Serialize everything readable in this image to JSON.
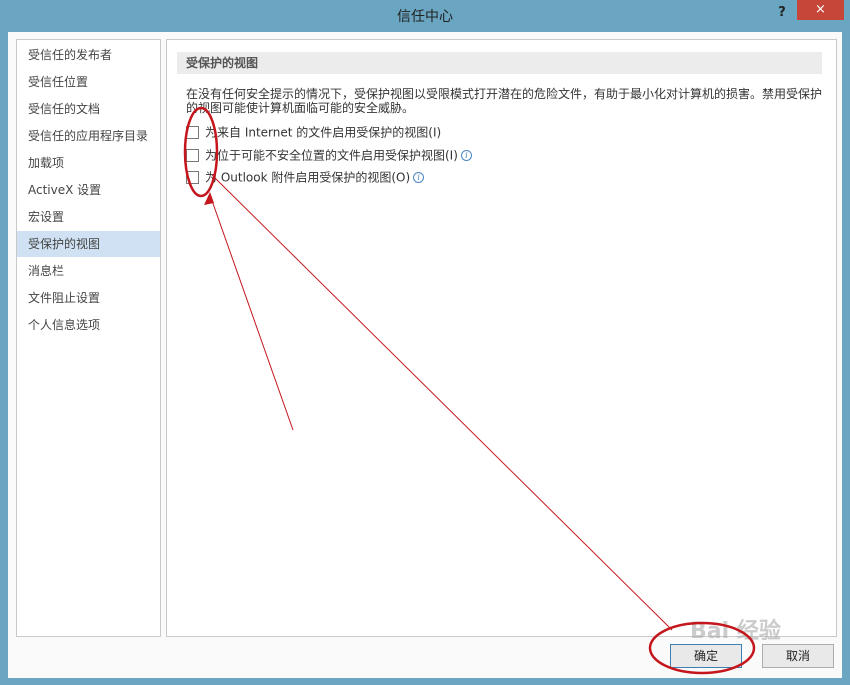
{
  "window": {
    "title": "信任中心",
    "help_label": "?",
    "close_label": "×"
  },
  "sidebar": {
    "items": [
      {
        "label": "受信任的发布者"
      },
      {
        "label": "受信任位置"
      },
      {
        "label": "受信任的文档"
      },
      {
        "label": "受信任的应用程序目录"
      },
      {
        "label": "加载项"
      },
      {
        "label": "ActiveX 设置"
      },
      {
        "label": "宏设置"
      },
      {
        "label": "受保护的视图"
      },
      {
        "label": "消息栏"
      },
      {
        "label": "文件阻止设置"
      },
      {
        "label": "个人信息选项"
      }
    ],
    "selected_index": 7
  },
  "main": {
    "section_title": "受保护的视图",
    "description": "在没有任何安全提示的情况下，受保护视图以受限模式打开潜在的危险文件，有助于最小化对计算机的损害。禁用受保护的视图可能使计算机面临可能的安全威胁。",
    "options": [
      {
        "label": "为来自 Internet 的文件启用受保护的视图(I)",
        "checked": false,
        "info": false
      },
      {
        "label": "为位于可能不安全位置的文件启用受保护视图(I)",
        "checked": false,
        "info": true
      },
      {
        "label": "为 Outlook 附件启用受保护的视图(O)",
        "checked": false,
        "info": true
      }
    ]
  },
  "footer": {
    "ok_label": "确定",
    "cancel_label": "取消"
  },
  "watermark": {
    "text": "Bai 经验"
  },
  "colors": {
    "titlebar": "#6aa6c2",
    "close_button": "#c7463a",
    "selected_item": "#cfe1f2",
    "annotation": "#c4161c"
  },
  "icons": {
    "info": "info-circle-icon"
  }
}
